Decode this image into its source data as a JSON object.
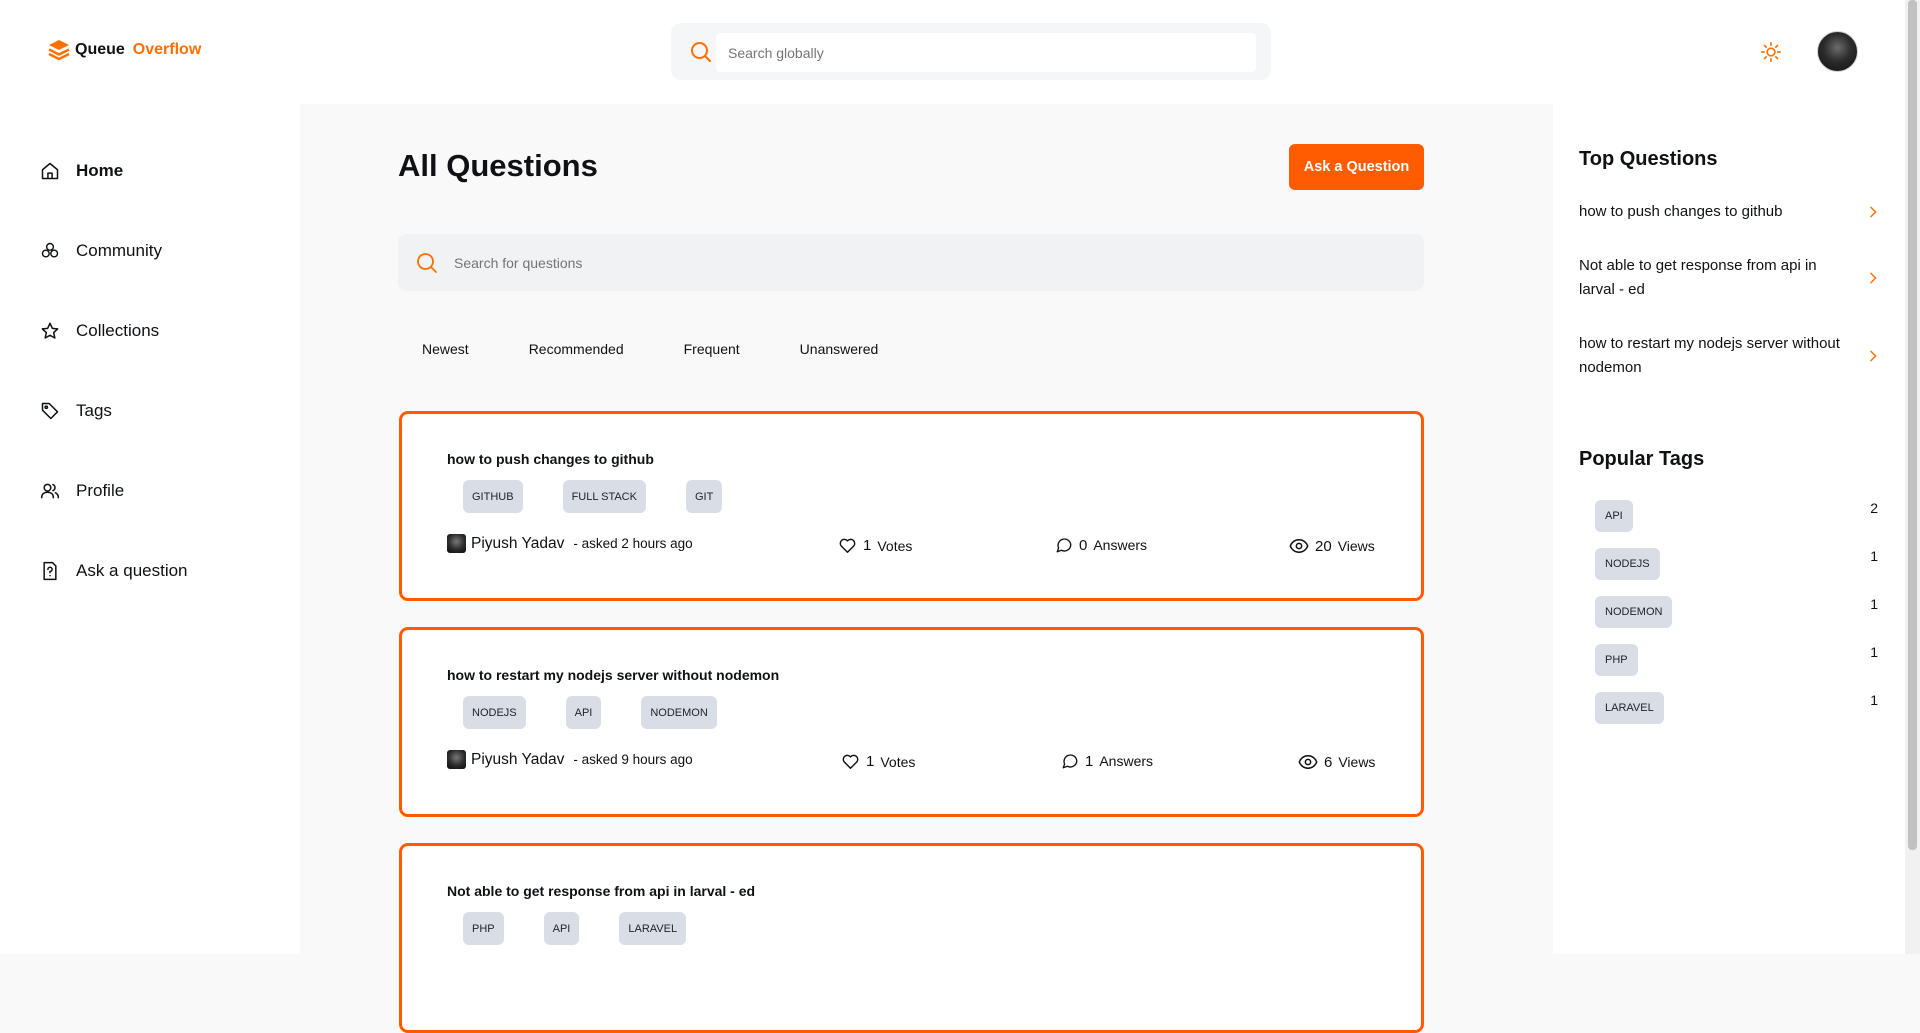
{
  "brand": {
    "name_part1": "Queue",
    "name_part2": "Overflow",
    "accent": "#ff7000"
  },
  "global_search": {
    "placeholder": "Search globally"
  },
  "sidebar": {
    "items": [
      {
        "label": "Home",
        "icon": "home-icon",
        "active": true
      },
      {
        "label": "Community",
        "icon": "community-icon"
      },
      {
        "label": "Collections",
        "icon": "star-icon"
      },
      {
        "label": "Tags",
        "icon": "tag-icon"
      },
      {
        "label": "Profile",
        "icon": "user-icon"
      },
      {
        "label": "Ask a question",
        "icon": "question-icon"
      }
    ]
  },
  "main": {
    "title": "All Questions",
    "ask_button": "Ask a Question",
    "search_placeholder": "Search for questions",
    "filters": [
      "Newest",
      "Recommended",
      "Frequent",
      "Unanswered"
    ],
    "questions": [
      {
        "title": "how to push changes to github",
        "tags": [
          "GITHUB",
          "FULL STACK",
          "GIT"
        ],
        "author": "Piyush Yadav",
        "asked": "- asked 2 hours ago",
        "votes": "1",
        "votes_label": "Votes",
        "answers": "0",
        "answers_label": "Answers",
        "views": "20",
        "views_label": "Views"
      },
      {
        "title": "how to restart my nodejs server without nodemon",
        "tags": [
          "NODEJS",
          "API",
          "NODEMON"
        ],
        "author": "Piyush Yadav",
        "asked": "- asked 9 hours ago",
        "votes": "1",
        "votes_label": "Votes",
        "answers": "1",
        "answers_label": "Answers",
        "views": "6",
        "views_label": "Views"
      },
      {
        "title": "Not able to get response from api in larval - ed",
        "tags": [
          "PHP",
          "API",
          "LARAVEL"
        ]
      }
    ]
  },
  "right": {
    "top_questions_title": "Top Questions",
    "top_questions": [
      "how to push changes to github",
      "Not able to get response from api in larval - ed",
      "how to restart my nodejs server without nodemon"
    ],
    "popular_tags_title": "Popular Tags",
    "popular_tags": [
      {
        "name": "API",
        "count": "2"
      },
      {
        "name": "NODEJS",
        "count": "1"
      },
      {
        "name": "NODEMON",
        "count": "1"
      },
      {
        "name": "PHP",
        "count": "1"
      },
      {
        "name": "LARAVEL",
        "count": "1"
      }
    ]
  }
}
